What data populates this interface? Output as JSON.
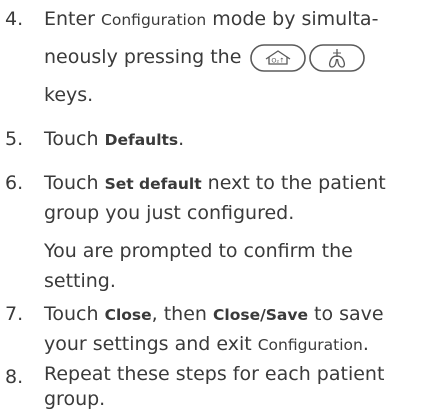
{
  "steps": [
    {
      "number": "4.",
      "lines": [
        [
          "Enter ",
          "Configuration",
          " mode by simulta-"
        ],
        [
          "neously pressing the "
        ],
        [
          "keys."
        ]
      ]
    },
    {
      "number": "5.",
      "lines": [
        [
          "Touch ",
          "Defaults",
          "."
        ]
      ]
    },
    {
      "number": "6.",
      "lines": [
        [
          "Touch ",
          "Set default",
          " next to the patient"
        ],
        [
          "group you just configured."
        ]
      ],
      "note_lines": [
        "You are prompted to confirm the",
        "setting."
      ]
    },
    {
      "number": "7.",
      "lines": [
        [
          "Touch ",
          "Close",
          ", then ",
          "Close/Save",
          " to save"
        ],
        [
          "your settings and exit ",
          "Configuration",
          "."
        ]
      ]
    },
    {
      "number": "8.",
      "lines": [
        [
          "Repeat these steps for each patient"
        ],
        [
          "group."
        ]
      ]
    }
  ],
  "keys": [
    {
      "icon": "home-o2-key-icon"
    },
    {
      "icon": "lungs-key-icon"
    }
  ]
}
